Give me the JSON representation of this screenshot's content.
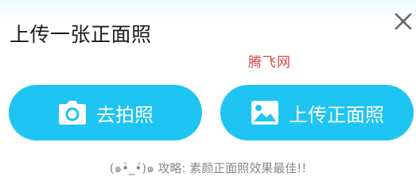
{
  "dialog": {
    "title": "上传一张正面照",
    "close_icon": "close-icon",
    "watermark": "腾飞网"
  },
  "buttons": {
    "camera": {
      "label": "去拍照",
      "icon": "camera-icon"
    },
    "upload": {
      "label": "上传正面照",
      "icon": "image-icon"
    }
  },
  "tip": "(๑•̀_•́)๑ 攻略: 素颜正面照效果最佳!!",
  "colors": {
    "button_bg": "#1ec4f2",
    "button_text": "#ffffff",
    "title_text": "#1a1a1a",
    "tip_text": "#888888",
    "watermark_text": "#d64545",
    "close_icon": "#666666"
  }
}
